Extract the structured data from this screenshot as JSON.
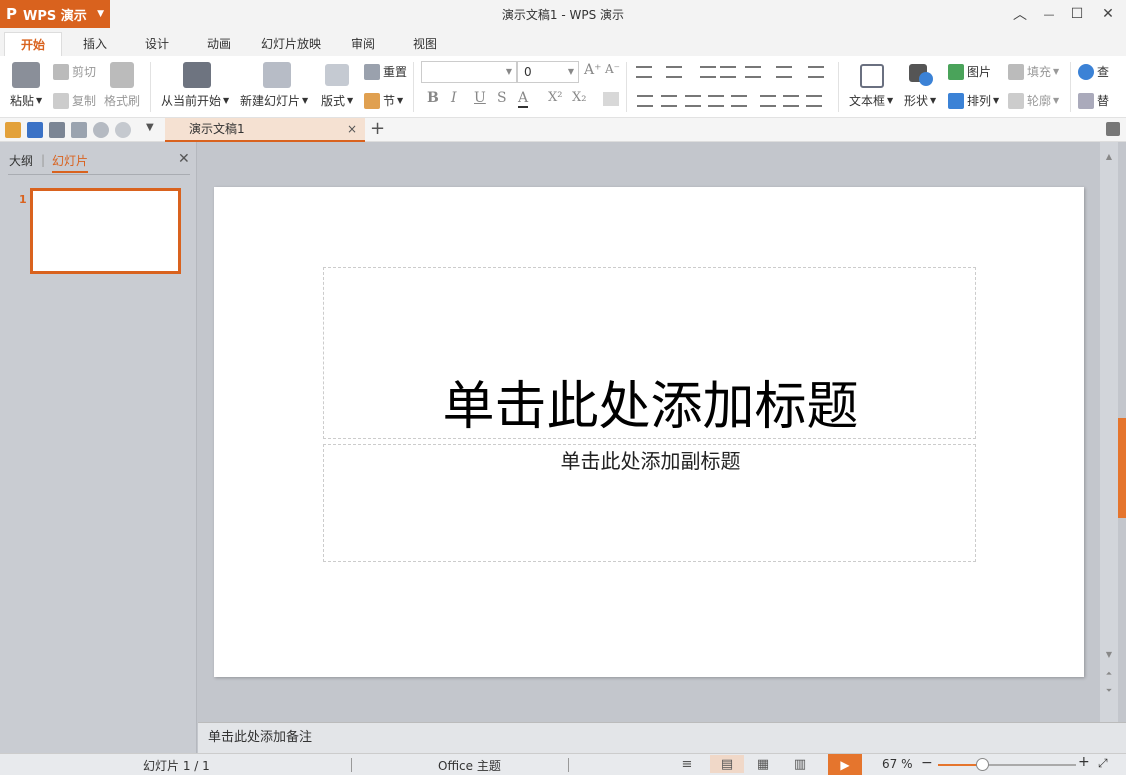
{
  "titlebar": {
    "app_menu_label": "WPS 演示",
    "app_logo": "P",
    "window_title": "演示文稿1 - WPS 演示",
    "buttons": {
      "ribbon_toggle": "︿",
      "minimize": "—",
      "maximize": "☐",
      "close": "✕"
    }
  },
  "ribbon_tabs": [
    "开始",
    "插入",
    "设计",
    "动画",
    "幻灯片放映",
    "审阅",
    "视图"
  ],
  "ribbon": {
    "paste": "粘贴",
    "cut": "剪切",
    "copy": "复制",
    "format_painter": "格式刷",
    "from_current": "从当前开始",
    "new_slide": "新建幻灯片",
    "layout": "版式",
    "reset": "重置",
    "section": "节",
    "font_size": "0",
    "text_box": "文本框",
    "shape": "形状",
    "picture": "图片",
    "arrange": "排列",
    "fill": "填充",
    "outline": "轮廓",
    "find": "查",
    "replace": "替",
    "format_glyphs": {
      "bold": "B",
      "italic": "I",
      "underline": "U",
      "strike": "S",
      "color": "A",
      "sup": "X²",
      "sub": "X₂",
      "grow": "A⁺",
      "shrink": "A⁻"
    }
  },
  "quick_access": {
    "doc_tab": "演示文稿1",
    "close": "×",
    "add": "+"
  },
  "left_panel": {
    "tab_outline": "大纲",
    "tab_slides": "幻灯片",
    "divider": "|",
    "close": "✕",
    "thumb_number": "1"
  },
  "slide": {
    "title_placeholder": "单击此处添加标题",
    "subtitle_placeholder": "单击此处添加副标题"
  },
  "notes_placeholder": "单击此处添加备注",
  "status": {
    "slide_count": "幻灯片 1 / 1",
    "theme": "Office 主题",
    "zoom": "67 %",
    "zoom_level": 0.32
  },
  "colors": {
    "accent": "#d9621e",
    "accent_light": "#e5752d"
  }
}
